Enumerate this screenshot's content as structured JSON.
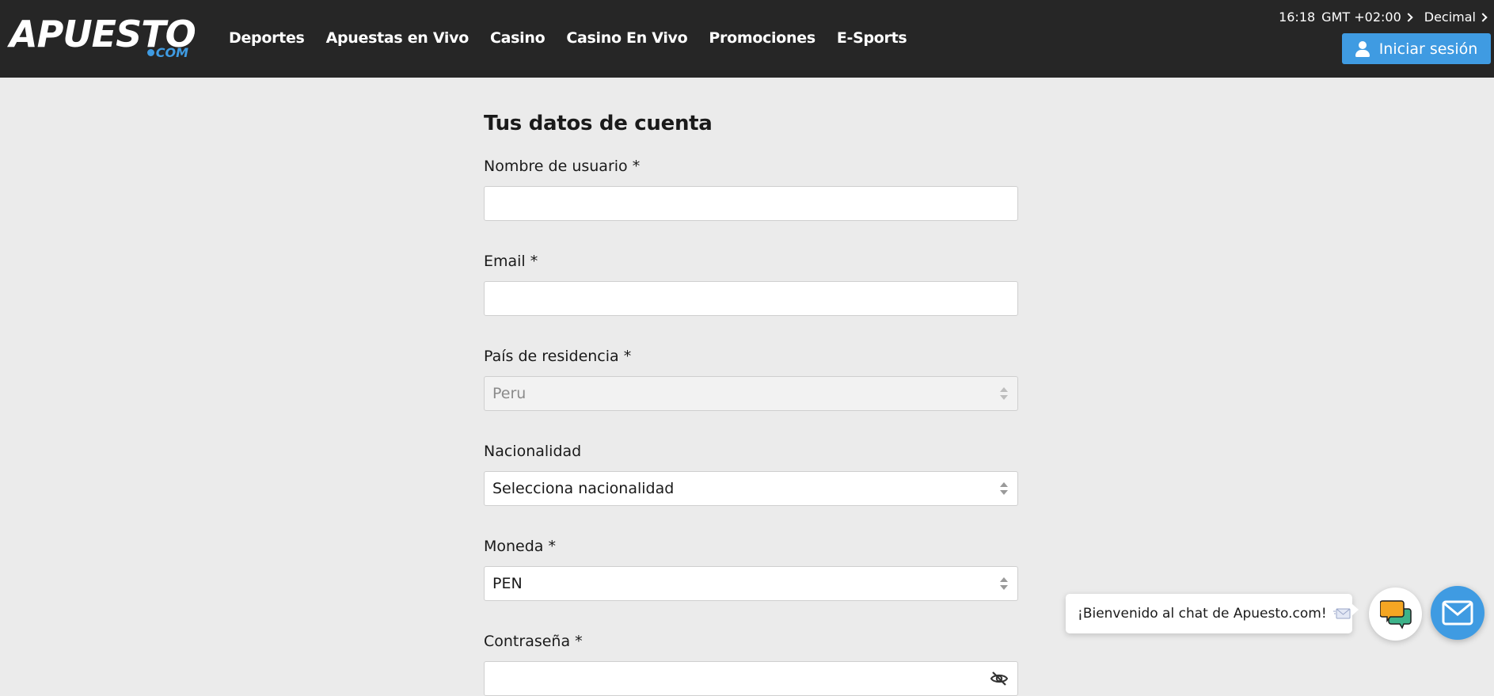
{
  "header": {
    "logo_main": "APUESTO",
    "logo_sub": "COM",
    "nav": [
      {
        "label": "Deportes"
      },
      {
        "label": "Apuestas en Vivo"
      },
      {
        "label": "Casino"
      },
      {
        "label": "Casino En Vivo"
      },
      {
        "label": "Promociones"
      },
      {
        "label": "E-Sports"
      }
    ],
    "time": "16:18",
    "timezone": "GMT +02:00",
    "odds_format": "Decimal",
    "login_label": "Iniciar sesión"
  },
  "form": {
    "title": "Tus datos de cuenta",
    "username": {
      "label": "Nombre de usuario *",
      "value": ""
    },
    "email": {
      "label": "Email *",
      "value": ""
    },
    "country": {
      "label": "País de residencia *",
      "selected": "Peru",
      "disabled": true
    },
    "nationality": {
      "label": "Nacionalidad",
      "selected": "Selecciona nacionalidad"
    },
    "currency": {
      "label": "Moneda *",
      "selected": "PEN"
    },
    "password": {
      "label": "Contraseña *",
      "value": ""
    }
  },
  "chat": {
    "welcome": "¡Bienvenido al chat de Apuesto.com!"
  },
  "colors": {
    "header_bg": "#262626",
    "accent": "#3f9be2",
    "page_bg": "#ebebeb"
  },
  "icons": [
    "user-icon",
    "chevron-right-icon",
    "select-arrows-icon",
    "eye-off-icon",
    "chat-bubbles-icon",
    "envelope-icon"
  ]
}
